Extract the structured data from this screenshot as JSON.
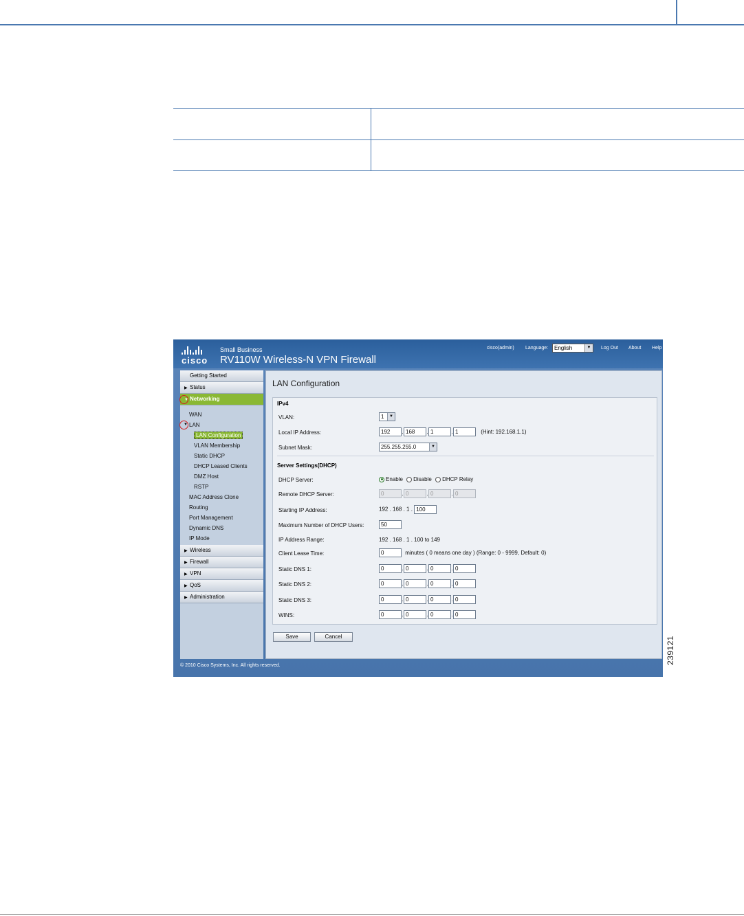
{
  "header": {
    "brand": "cisco",
    "small_business": "Small Business",
    "product": "RV110W Wireless-N VPN Firewall",
    "user": "cisco(admin)",
    "language_label": "Language:",
    "language_value": "English",
    "logout": "Log Out",
    "about": "About",
    "help": "Help"
  },
  "sidebar": {
    "getting_started": "Getting Started",
    "status": "Status",
    "networking": "Networking",
    "wan": "WAN",
    "lan": "LAN",
    "lan_items": [
      "LAN Configuration",
      "VLAN Membership",
      "Static DHCP",
      "DHCP Leased Clients",
      "DMZ Host",
      "RSTP"
    ],
    "net_items": [
      "MAC Address Clone",
      "Routing",
      "Port Management",
      "Dynamic DNS",
      "IP Mode"
    ],
    "wireless": "Wireless",
    "firewall": "Firewall",
    "vpn": "VPN",
    "qos": "QoS",
    "administration": "Administration"
  },
  "main": {
    "title": "LAN Configuration",
    "ipv4_title": "IPv4",
    "vlan_label": "VLAN:",
    "vlan_value": "1",
    "local_ip_label": "Local IP Address:",
    "local_ip": [
      "192",
      "168",
      "1",
      "1"
    ],
    "local_ip_hint": "(Hint: 192.168.1.1)",
    "subnet_label": "Subnet Mask:",
    "subnet_value": "255.255.255.0",
    "dhcp_title": "Server Settings(DHCP)",
    "dhcp_server_label": "DHCP Server:",
    "dhcp_options": [
      "Enable",
      "Disable",
      "DHCP Relay"
    ],
    "remote_dhcp_label": "Remote DHCP Server:",
    "remote_dhcp": [
      "0",
      "0",
      "0",
      "0"
    ],
    "start_ip_label": "Starting IP Address:",
    "start_ip_prefix": "192 . 168 . 1 .",
    "start_ip_last": "100",
    "max_users_label": "Maximum Number of DHCP Users:",
    "max_users": "50",
    "ip_range_label": "IP Address Range:",
    "ip_range": "192 . 168 . 1 . 100 to 149",
    "lease_label": "Client Lease Time:",
    "lease_value": "0",
    "lease_hint": "minutes ( 0 means one day )  (Range: 0 - 9999, Default: 0)",
    "dns1_label": "Static DNS 1:",
    "dns1": [
      "0",
      "0",
      "0",
      "0"
    ],
    "dns2_label": "Static DNS 2:",
    "dns2": [
      "0",
      "0",
      "0",
      "0"
    ],
    "dns3_label": "Static DNS 3:",
    "dns3": [
      "0",
      "0",
      "0",
      "0"
    ],
    "wins_label": "WINS:",
    "wins": [
      "0",
      "0",
      "0",
      "0"
    ],
    "save": "Save",
    "cancel": "Cancel"
  },
  "footer": "© 2010 Cisco Systems, Inc. All rights reserved.",
  "figure_id": "239121",
  "colors": {
    "rule_blue": "#4a78b0",
    "header_blue": "#2b5f9c",
    "accent_green": "#8ab834",
    "callout_red": "#d21f1f"
  }
}
